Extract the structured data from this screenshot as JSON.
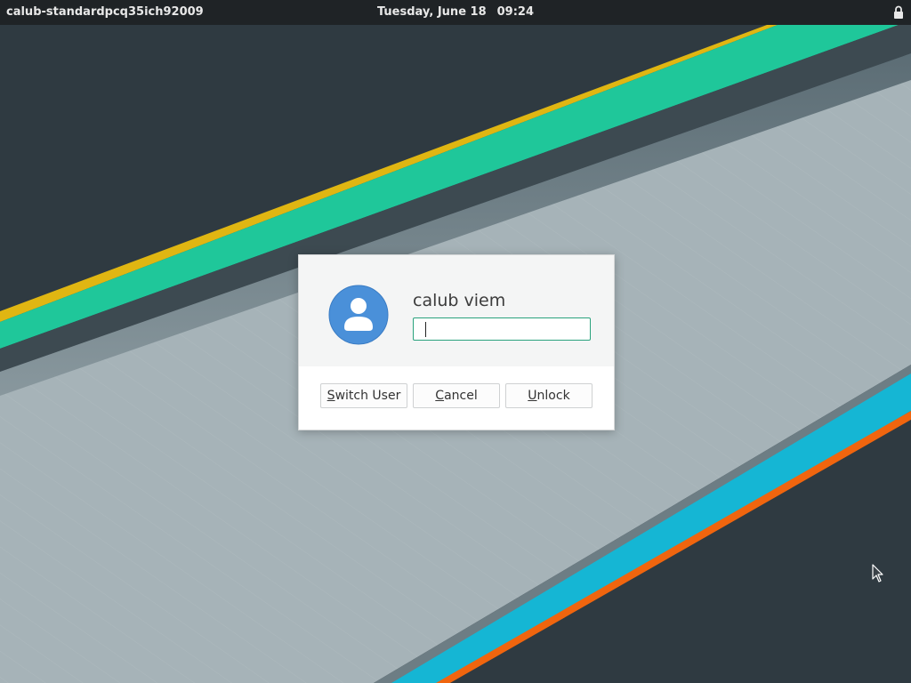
{
  "topbar": {
    "hostname": "calub-standardpcq35ich92009",
    "date": "Tuesday, June 18",
    "time": "09:24",
    "status_icon": "lock-icon"
  },
  "dialog": {
    "username": "calub viem",
    "avatar_icon": "user-avatar-icon",
    "password_value": "",
    "buttons": {
      "switch_user": {
        "mnemonic": "S",
        "rest": "witch User"
      },
      "cancel": {
        "mnemonic": "C",
        "rest": "ancel"
      },
      "unlock": {
        "mnemonic": "U",
        "rest": "nlock"
      }
    }
  },
  "colors": {
    "background": "#2f3a41",
    "stripe_yellow": "#e0b612",
    "stripe_green": "#1fc79a",
    "stripe_cyan": "#15b6d4",
    "stripe_orange": "#f0650e",
    "avatar_blue": "#4a90d9",
    "focus_border": "#2aa27d"
  }
}
